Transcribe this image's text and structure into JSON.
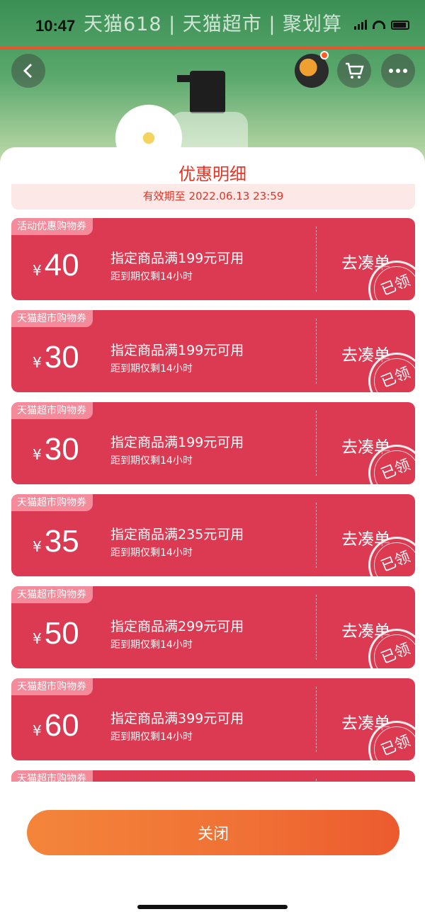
{
  "status_bar": {
    "time": "10:47"
  },
  "banner": {
    "text": "天猫618 | 天猫超市 | 聚划算"
  },
  "sheet": {
    "title": "优惠明细",
    "validity": "有效期至 2022.06.13 23:59",
    "coupons": [
      {
        "tag": "活动优惠购物券",
        "currency": "¥",
        "amount": "40",
        "condition": "指定商品满199元可用",
        "expiry": "距到期仅剩14小时",
        "action": "去凑单",
        "stamp": "已领"
      },
      {
        "tag": "天猫超市购物券",
        "currency": "¥",
        "amount": "30",
        "condition": "指定商品满199元可用",
        "expiry": "距到期仅剩14小时",
        "action": "去凑单",
        "stamp": "已领"
      },
      {
        "tag": "天猫超市购物券",
        "currency": "¥",
        "amount": "30",
        "condition": "指定商品满199元可用",
        "expiry": "距到期仅剩14小时",
        "action": "去凑单",
        "stamp": "已领"
      },
      {
        "tag": "天猫超市购物券",
        "currency": "¥",
        "amount": "35",
        "condition": "指定商品满235元可用",
        "expiry": "距到期仅剩14小时",
        "action": "去凑单",
        "stamp": "已领"
      },
      {
        "tag": "天猫超市购物券",
        "currency": "¥",
        "amount": "50",
        "condition": "指定商品满299元可用",
        "expiry": "距到期仅剩14小时",
        "action": "去凑单",
        "stamp": "已领"
      },
      {
        "tag": "天猫超市购物券",
        "currency": "¥",
        "amount": "60",
        "condition": "指定商品满399元可用",
        "expiry": "距到期仅剩14小时",
        "action": "去凑单",
        "stamp": "已领"
      },
      {
        "tag": "天猫超市购物券"
      }
    ],
    "close_label": "关闭"
  },
  "icons": {
    "back": "chevron-left-icon",
    "cart": "cart-icon",
    "more": "more-icon"
  },
  "colors": {
    "coupon_bg": "#dc3a52",
    "accent": "#e33424",
    "button_gradient_start": "#f3853a",
    "button_gradient_end": "#ec5a2e"
  }
}
